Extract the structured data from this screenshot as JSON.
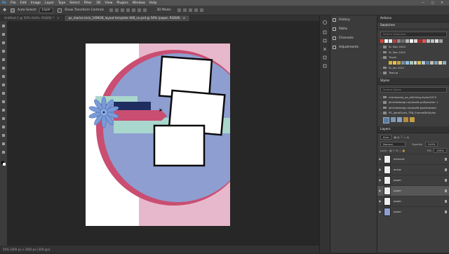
{
  "menu": [
    "File",
    "Edit",
    "Image",
    "Layer",
    "Type",
    "Select",
    "Filter",
    "3D",
    "View",
    "Plugins",
    "Window",
    "Help"
  ],
  "options": {
    "auto_select": "Auto-Select:",
    "auto_select_target": "Layer",
    "show_transform": "Show Transform Controls",
    "mode_3d": "3D Mode:"
  },
  "tabs": [
    {
      "label": "Untitled-1 @ 50% (Sofie, RGB/8) *",
      "active": false
    },
    {
      "label": "ps_marisa lerin_100628_layout template 408_co.psd @ 50% (paper, RGB/8)",
      "active": true
    }
  ],
  "status": {
    "text": "50%     2400 px x 3000 px (300 ppi)"
  },
  "collapsed_panels": [
    {
      "icon": "history-icon",
      "label": "History"
    },
    {
      "icon": "paths-icon",
      "label": "Paths"
    },
    {
      "icon": "channels-icon",
      "label": "Channels"
    },
    {
      "icon": "adjustments-icon",
      "label": "Adjustments"
    }
  ],
  "actions": {
    "title": "Actions"
  },
  "swatches": {
    "title": "Swatches",
    "search_placeholder": "Search Swatches",
    "recent": [
      "#d6453d",
      "#ffffff",
      "#e8e8e8",
      "#c43b3b",
      "#8a8a8a",
      "#6d6d6d",
      "#b8b8b8",
      "#ffffff",
      "#d9d9d9",
      "#a83232",
      "#e55656",
      "#bebebe",
      "#c0c0c0",
      "#dcdcdc",
      "#a0a0a0"
    ],
    "groups": [
      {
        "label": "SL Nov 2020"
      },
      {
        "label": "SL Dec 2020"
      },
      {
        "label": "Travel"
      },
      {
        "label": "SL Jan 2021"
      },
      {
        "label": "Teacup"
      }
    ],
    "travel_colors": [
      "#d8b33a",
      "#e2c24f",
      "#c9a33b",
      "#6d8fb5",
      "#98b9d6",
      "#a9c9c0",
      "#d0d4c4",
      "#dac05a",
      "#b0c7d9",
      "#5e7fa4",
      "#c7c0a8",
      "#7e9dbd",
      "#e7d9a6",
      "#8bb0c6"
    ]
  },
  "styles": {
    "title": "Styles",
    "search_placeholder": "Search Styles",
    "items": [
      "marinaxolu_ps_stitching-styles2013",
      "jahirdadesign-stylesdft-puffysticker 1",
      "jahirdadesign-stylesdft-pastedwood",
      "PS_JanetScott_TSB_EnamelBrStyles"
    ]
  },
  "layers": {
    "title": "Layers",
    "kind_label": "Kind",
    "blend_mode": "Normal",
    "opacity_label": "Opacity:",
    "opacity_value": "100%",
    "lock_label": "Lock:",
    "fill_label": "Fill:",
    "fill_value": "100%",
    "items": [
      {
        "name": "element",
        "selected": false
      },
      {
        "name": "arrow",
        "selected": false
      },
      {
        "name": "paper",
        "selected": false
      },
      {
        "name": "paper",
        "selected": true
      },
      {
        "name": "paper",
        "selected": false
      },
      {
        "name": "paper",
        "selected": false
      }
    ]
  },
  "document": {
    "colors": {
      "pink": "#e7b8cb",
      "blue": "#8e9ed0",
      "crimson": "#c94e72",
      "navy": "#1f2d60",
      "mint": "#a9d7cd",
      "flower": "#7a9bd8"
    }
  }
}
